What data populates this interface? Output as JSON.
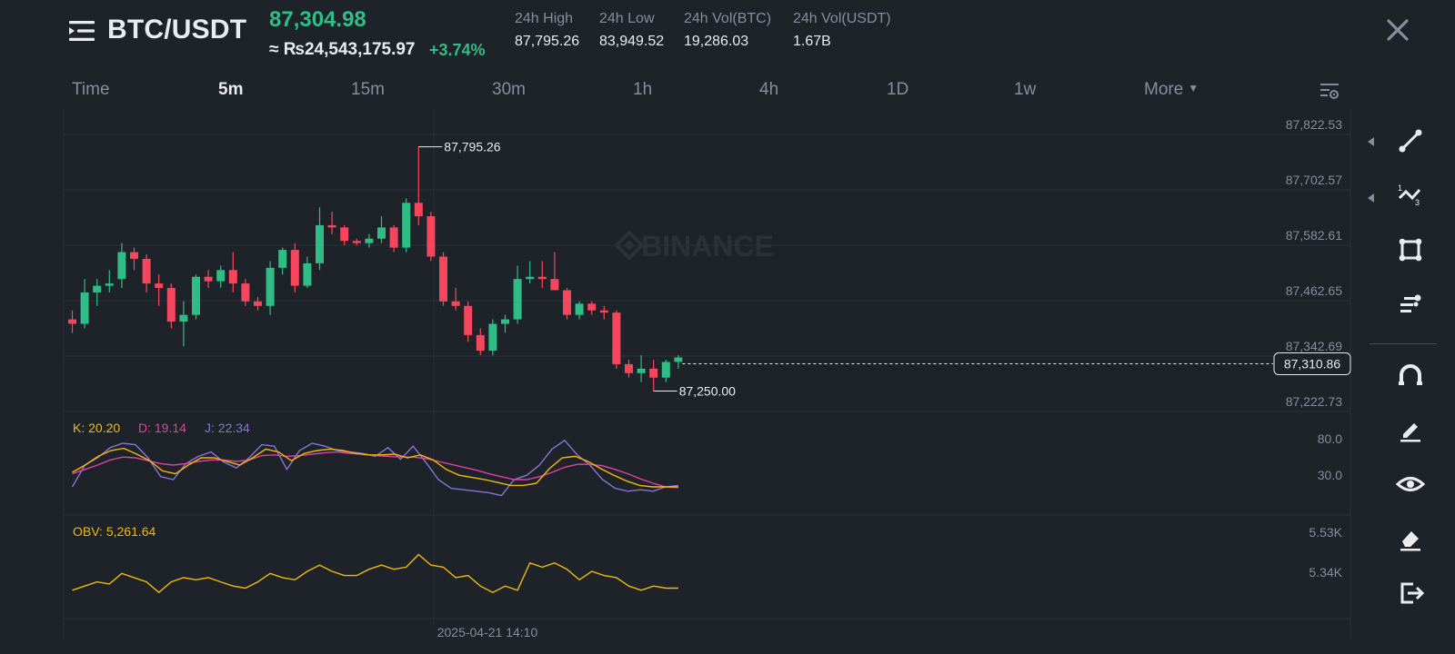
{
  "header": {
    "pair": "BTC/USDT",
    "last_price": "87,304.98",
    "fiat_price": "≈ ₨24,543,175.97",
    "change_pct": "+3.74%",
    "stats": [
      {
        "label": "24h High",
        "value": "87,795.26"
      },
      {
        "label": "24h Low",
        "value": "83,949.52"
      },
      {
        "label": "24h Vol(BTC)",
        "value": "19,286.03"
      },
      {
        "label": "24h Vol(USDT)",
        "value": "1.67B"
      }
    ]
  },
  "timeframes": {
    "items": [
      "Time",
      "5m",
      "15m",
      "30m",
      "1h",
      "4h",
      "1D",
      "1w",
      "More"
    ],
    "active": "5m"
  },
  "icons": {
    "menu": "hamburger-menu-icon",
    "close": "close-icon",
    "chart_settings": "chart-settings-icon",
    "tools": [
      "trend-line-icon",
      "fibonacci-icon",
      "rectangle-icon",
      "pattern-icon",
      "magnet-icon",
      "pencil-icon",
      "eye-icon",
      "eraser-icon",
      "exit-icon"
    ]
  },
  "colors": {
    "up": "#2ebd85",
    "down": "#f6465d",
    "bg": "#1e2329",
    "k_line": "#f0b90b",
    "d_line": "#e040a8",
    "j_line": "#8a72d6",
    "obv_line": "#f0b90b"
  },
  "chart": {
    "watermark": "BINANCE",
    "price_axis": [
      "87,822.53",
      "87,702.57",
      "87,582.61",
      "87,462.65",
      "87,342.69",
      "87,222.73"
    ],
    "current_price_label": "87,310.86",
    "current_price": 87310.86,
    "high_marker": "87,795.26",
    "low_marker": "87,250.00",
    "crosshair_time": "2025-04-21 14:10",
    "kdj": {
      "k_label": "K: 20.20",
      "d_label": "D: 19.14",
      "j_label": "J: 22.34",
      "axis": [
        "80.0",
        "30.0"
      ]
    },
    "obv": {
      "label": "OBV: 5,261.64",
      "axis": [
        "5.53K",
        "5.34K"
      ]
    }
  },
  "chart_data": {
    "type": "candlestick",
    "interval": "5m",
    "series": [
      {
        "name": "BTC/USDT",
        "ohlc": [
          [
            87410,
            87430,
            87380,
            87400
          ],
          [
            87400,
            87500,
            87390,
            87470
          ],
          [
            87470,
            87500,
            87440,
            87485
          ],
          [
            87485,
            87520,
            87470,
            87490
          ],
          [
            87500,
            87580,
            87480,
            87560
          ],
          [
            87560,
            87570,
            87520,
            87545
          ],
          [
            87545,
            87555,
            87470,
            87490
          ],
          [
            87490,
            87510,
            87440,
            87480
          ],
          [
            87480,
            87490,
            87390,
            87405
          ],
          [
            87405,
            87450,
            87350,
            87420
          ],
          [
            87420,
            87510,
            87410,
            87505
          ],
          [
            87505,
            87520,
            87480,
            87495
          ],
          [
            87495,
            87530,
            87480,
            87520
          ],
          [
            87520,
            87560,
            87470,
            87490
          ],
          [
            87490,
            87500,
            87440,
            87450
          ],
          [
            87450,
            87460,
            87430,
            87440
          ],
          [
            87440,
            87540,
            87420,
            87525
          ],
          [
            87525,
            87570,
            87510,
            87565
          ],
          [
            87565,
            87580,
            87470,
            87485
          ],
          [
            87485,
            87550,
            87480,
            87535
          ],
          [
            87535,
            87660,
            87520,
            87620
          ],
          [
            87620,
            87650,
            87600,
            87615
          ],
          [
            87615,
            87620,
            87575,
            87585
          ],
          [
            87585,
            87590,
            87575,
            87580
          ],
          [
            87580,
            87600,
            87570,
            87590
          ],
          [
            87590,
            87640,
            87580,
            87615
          ],
          [
            87615,
            87620,
            87560,
            87570
          ],
          [
            87570,
            87680,
            87560,
            87670
          ],
          [
            87670,
            87795,
            87620,
            87640
          ],
          [
            87640,
            87650,
            87540,
            87550
          ],
          [
            87550,
            87560,
            87440,
            87450
          ],
          [
            87450,
            87480,
            87430,
            87440
          ],
          [
            87440,
            87450,
            87360,
            87375
          ],
          [
            87375,
            87390,
            87330,
            87340
          ],
          [
            87340,
            87410,
            87330,
            87400
          ],
          [
            87400,
            87420,
            87380,
            87410
          ],
          [
            87410,
            87530,
            87400,
            87500
          ],
          [
            87500,
            87540,
            87490,
            87505
          ],
          [
            87505,
            87540,
            87480,
            87500
          ],
          [
            87500,
            87560,
            87480,
            87475
          ],
          [
            87475,
            87480,
            87410,
            87420
          ],
          [
            87420,
            87450,
            87410,
            87445
          ],
          [
            87445,
            87450,
            87420,
            87430
          ],
          [
            87430,
            87440,
            87410,
            87425
          ],
          [
            87425,
            87430,
            87300,
            87310
          ],
          [
            87310,
            87320,
            87280,
            87290
          ],
          [
            87290,
            87330,
            87270,
            87300
          ],
          [
            87300,
            87320,
            87250,
            87280
          ],
          [
            87280,
            87320,
            87270,
            87315
          ],
          [
            87315,
            87330,
            87300,
            87325
          ]
        ]
      }
    ],
    "kdj": {
      "K": [
        40,
        50,
        62,
        70,
        73,
        65,
        56,
        42,
        38,
        50,
        60,
        60,
        55,
        50,
        60,
        72,
        68,
        56,
        66,
        70,
        72,
        70,
        66,
        64,
        64,
        65,
        60,
        64,
        57,
        44,
        36,
        33,
        30,
        26,
        22,
        22,
        25,
        45,
        60,
        62,
        55,
        45,
        36,
        28,
        22,
        20,
        20,
        20
      ],
      "D": [
        38,
        44,
        50,
        57,
        61,
        60,
        56,
        52,
        50,
        52,
        55,
        57,
        57,
        55,
        57,
        63,
        64,
        62,
        63,
        65,
        67,
        68,
        66,
        65,
        63,
        62,
        61,
        61,
        59,
        55,
        51,
        47,
        43,
        38,
        34,
        30,
        30,
        34,
        40,
        47,
        51,
        51,
        49,
        44,
        38,
        31,
        25,
        20,
        19
      ],
      "J": [
        20,
        50,
        60,
        74,
        80,
        78,
        60,
        34,
        30,
        52,
        62,
        68,
        54,
        46,
        60,
        78,
        76,
        44,
        70,
        80,
        76,
        70,
        68,
        66,
        62,
        74,
        58,
        76,
        54,
        30,
        18,
        16,
        14,
        12,
        8,
        30,
        36,
        50,
        72,
        84,
        64,
        50,
        30,
        18,
        14,
        16,
        14,
        20,
        22
      ]
    },
    "obv": [
      5.25,
      5.27,
      5.29,
      5.28,
      5.33,
      5.31,
      5.29,
      5.24,
      5.29,
      5.31,
      5.3,
      5.31,
      5.29,
      5.27,
      5.26,
      5.29,
      5.33,
      5.31,
      5.3,
      5.34,
      5.37,
      5.34,
      5.32,
      5.32,
      5.35,
      5.37,
      5.35,
      5.36,
      5.42,
      5.37,
      5.36,
      5.31,
      5.32,
      5.27,
      5.24,
      5.27,
      5.25,
      5.38,
      5.36,
      5.38,
      5.35,
      5.3,
      5.34,
      5.32,
      5.31,
      5.27,
      5.25,
      5.27,
      5.26,
      5.26
    ]
  }
}
